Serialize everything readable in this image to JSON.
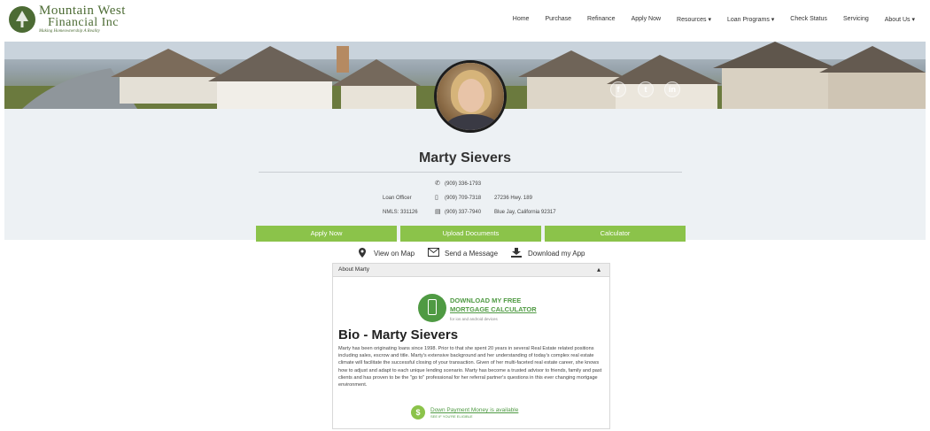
{
  "brand": {
    "name_line1": "Mountain West",
    "name_line2": "Financial Inc",
    "tagline": "Making Homeownership A Reality"
  },
  "nav": {
    "items": [
      "Home",
      "Purchase",
      "Refinance",
      "Apply Now",
      "Resources ▾",
      "Loan Programs ▾",
      "Check Status",
      "Servicing",
      "About Us ▾"
    ]
  },
  "social": {
    "facebook": "f",
    "twitter": "t",
    "linkedin": "in"
  },
  "profile": {
    "name": "Marty Sievers",
    "title": "Loan Officer",
    "nmls": "NMLS: 331126",
    "phone": "(909) 336-1793",
    "mobile": "(909) 709-7318",
    "fax": "(909) 337-7940",
    "address1": "27236 Hwy. 189",
    "address2": "Blue Jay, California 92317"
  },
  "buttons": {
    "apply": "Apply Now",
    "upload": "Upload Documents",
    "calculator": "Calculator"
  },
  "links": {
    "map": "View on Map",
    "message": "Send a Message",
    "app": "Download my App"
  },
  "about": {
    "header": "About Marty",
    "toggle": "▴",
    "calc_line1": "DOWNLOAD MY FREE",
    "calc_line2": "MORTGAGE CALCULATOR",
    "calc_line3": "for ios and android devices",
    "bio_title": "Bio - Marty Sievers",
    "bio_text": "Marty has been originating loans since 1998. Prior to that she spent 20 years in several Real Estate related positions including sales, escrow and title. Marty's extensive background and her understanding of today's complex real estate climate will facilitate the successful closing of your transaction. Given of her multi-faceted real estate career, she knows how to adjust and adapt to each unique lending scenario. Marty has become a trusted advisor to friends, family and past clients and has proven to be the \"go to\" professional for her referral partner's questions in this ever changing mortgage environment.",
    "dp_line1": "Down Payment Money is available",
    "dp_line2": "SEE IF YOU'RE ELIGIBLE"
  },
  "icons": {
    "phone": "phone-icon",
    "mobile": "mobile-icon",
    "fax": "fax-icon",
    "map": "map-pin-icon",
    "message": "envelope-icon",
    "app": "download-icon"
  },
  "colors": {
    "accent": "#8bc34a",
    "brand": "#4c6b34",
    "band": "#edf1f4"
  }
}
